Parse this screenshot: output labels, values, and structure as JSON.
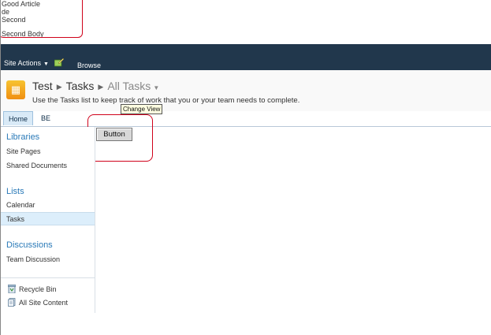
{
  "article": {
    "lines": [
      "Good Article",
      "de",
      "Second",
      "Second Body"
    ]
  },
  "ribbon": {
    "site_actions": "Site Actions",
    "browse": "Browse"
  },
  "breadcrumb": {
    "site": "Test",
    "list": "Tasks",
    "view": "All Tasks"
  },
  "description": "Use the Tasks list to keep track of work that you or your team needs to complete.",
  "topnav": {
    "tabs": [
      "Home",
      "BE"
    ]
  },
  "tooltip": "Change View",
  "button_label": "Button",
  "leftnav": {
    "libraries": {
      "heading": "Libraries",
      "items": [
        "Site Pages",
        "Shared Documents"
      ]
    },
    "lists": {
      "heading": "Lists",
      "items": [
        "Calendar",
        "Tasks"
      ]
    },
    "discussions": {
      "heading": "Discussions",
      "items": [
        "Team Discussion"
      ]
    },
    "footer": [
      "Recycle Bin",
      "All Site Content"
    ]
  },
  "colors": {
    "ribbon": "#21374c",
    "accent": "#2a7ab8",
    "annotation": "#d0021b"
  }
}
